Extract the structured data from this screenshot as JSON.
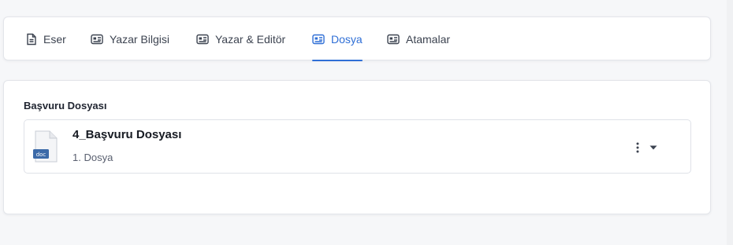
{
  "tabs": [
    {
      "label": "Eser",
      "icon": "document-icon",
      "active": false
    },
    {
      "label": "Yazar Bilgisi",
      "icon": "id-card-icon",
      "active": false
    },
    {
      "label": "Yazar & Editör",
      "icon": "id-card-icon",
      "active": false
    },
    {
      "label": "Dosya",
      "icon": "id-card-icon",
      "active": true
    },
    {
      "label": "Atamalar",
      "icon": "id-card-icon",
      "active": false
    }
  ],
  "section": {
    "title": "Başvuru Dosyası",
    "file": {
      "name": "4_Başvuru Dosyası",
      "subtitle": "1. Dosya",
      "icon_label": "doc",
      "icon": "doc-file-icon"
    }
  },
  "colors": {
    "accent": "#2f6fd6",
    "text": "#3c4350",
    "background": "#f6f7f9"
  }
}
